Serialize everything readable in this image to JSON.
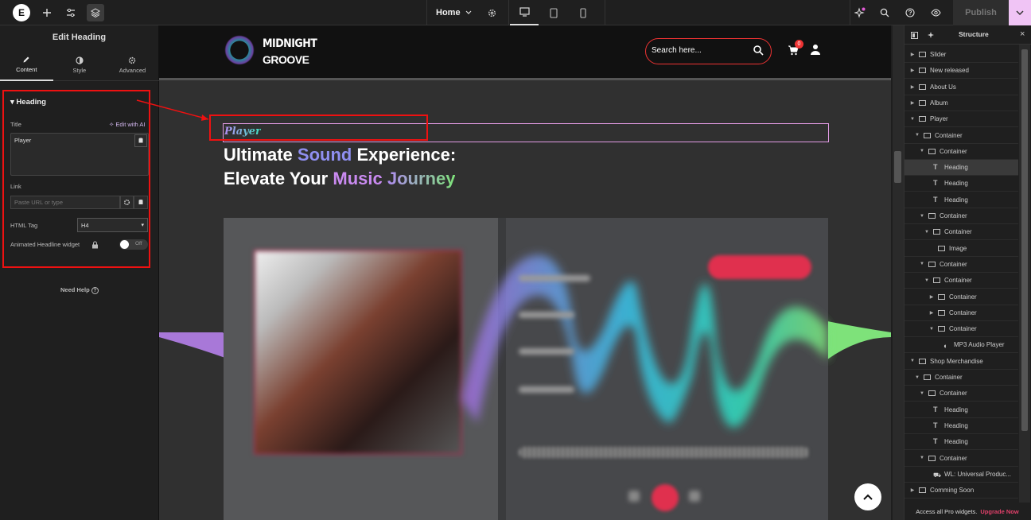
{
  "topbar": {
    "logo_text": "E",
    "page_selector": "Home",
    "publish_label": "Publish",
    "icons": [
      "elementor-logo-icon",
      "plus-icon",
      "sliders-icon",
      "layers-icon",
      "chevron-down-icon",
      "gear-icon",
      "desktop-icon",
      "tablet-icon",
      "mobile-icon",
      "ai-sparkle-icon",
      "search-icon",
      "help-icon",
      "eye-icon",
      "chevron-down-icon"
    ]
  },
  "left_panel": {
    "title": "Edit Heading",
    "tabs": [
      {
        "label": "Content",
        "icon": "pencil-icon"
      },
      {
        "label": "Style",
        "icon": "half-circle-icon"
      },
      {
        "label": "Advanced",
        "icon": "gear-icon"
      }
    ],
    "section_title": "Heading",
    "title_label": "Title",
    "edit_with_ai": "Edit with AI",
    "title_value": "Player",
    "link_label": "Link",
    "link_placeholder": "Paste URL or type",
    "html_tag_label": "HTML Tag",
    "html_tag_value": "H4",
    "animated_label": "Animated Headline widget",
    "toggle_state": "Off",
    "need_help": "Need Help"
  },
  "site": {
    "brand_line1": "MIDNIGHT",
    "brand_line2": "GROOVE",
    "search_placeholder": "Search here...",
    "cart_count": "0",
    "player_heading": "Player",
    "headline": {
      "l1_a": "Ultimate ",
      "l1_b": "Sound",
      "l1_c": " Experience:",
      "l2_a": "Elevate Your ",
      "l2_b": "Music",
      "l2_c": " ",
      "l2_d": "Journey"
    },
    "colors": {
      "accent_red": "#e0304e",
      "sound": "#8f8ff0",
      "music": "#c98af0",
      "highlight": "#e11111"
    }
  },
  "structure": {
    "title": "Structure",
    "items": [
      {
        "label": "Slider",
        "type": "container",
        "caret": "right"
      },
      {
        "label": "New released",
        "type": "container",
        "caret": "right"
      },
      {
        "label": "About Us",
        "type": "container",
        "caret": "right"
      },
      {
        "label": "Album",
        "type": "container",
        "caret": "right"
      },
      {
        "label": "Player",
        "type": "container",
        "caret": "down"
      },
      {
        "label": "Container",
        "type": "container",
        "caret": "down"
      },
      {
        "label": "Container",
        "type": "container",
        "caret": "down"
      },
      {
        "label": "Heading",
        "type": "heading",
        "caret": "",
        "selected": true
      },
      {
        "label": "Heading",
        "type": "heading",
        "caret": ""
      },
      {
        "label": "Heading",
        "type": "heading",
        "caret": ""
      },
      {
        "label": "Container",
        "type": "container",
        "caret": "down"
      },
      {
        "label": "Container",
        "type": "container",
        "caret": "down"
      },
      {
        "label": "Image",
        "type": "image",
        "caret": ""
      },
      {
        "label": "Container",
        "type": "container",
        "caret": "down"
      },
      {
        "label": "Container",
        "type": "container",
        "caret": "down"
      },
      {
        "label": "Container",
        "type": "container",
        "caret": "right"
      },
      {
        "label": "Container",
        "type": "container",
        "caret": "right"
      },
      {
        "label": "Container",
        "type": "container",
        "caret": "down"
      },
      {
        "label": "MP3 Audio Player",
        "type": "audio",
        "caret": ""
      },
      {
        "label": "Shop Merchandise",
        "type": "container",
        "caret": "down"
      },
      {
        "label": "Container",
        "type": "container",
        "caret": "down"
      },
      {
        "label": "Container",
        "type": "container",
        "caret": "down"
      },
      {
        "label": "Heading",
        "type": "heading",
        "caret": ""
      },
      {
        "label": "Heading",
        "type": "heading",
        "caret": ""
      },
      {
        "label": "Heading",
        "type": "heading",
        "caret": ""
      },
      {
        "label": "Container",
        "type": "container",
        "caret": "down"
      },
      {
        "label": "WL: Universal Produc...",
        "type": "cart",
        "caret": ""
      },
      {
        "label": "Comming Soon",
        "type": "container",
        "caret": "right"
      }
    ],
    "footer_text": "Access all Pro widgets.",
    "footer_link": "Upgrade Now"
  }
}
